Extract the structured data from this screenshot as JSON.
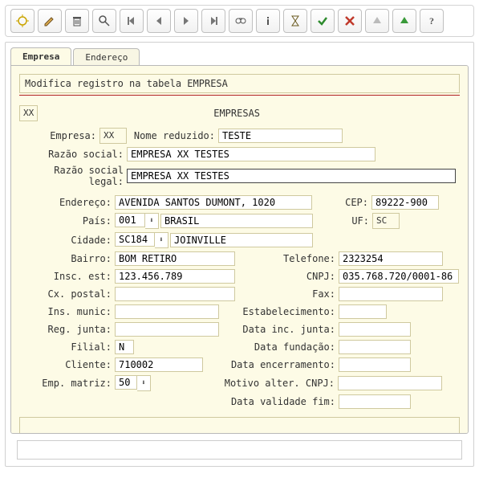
{
  "toolbar": {
    "icons": [
      "sun",
      "pencil",
      "trash",
      "zoom",
      "first",
      "prev",
      "next",
      "last",
      "binoculars",
      "info",
      "hourglass",
      "check-green",
      "x-red",
      "up-gray",
      "up-green",
      "help"
    ]
  },
  "tabs": {
    "empresa": "Empresa",
    "endereco": "Endereço"
  },
  "message": "Modifica registro na tabela EMPRESA",
  "section": {
    "code": "XX",
    "title": "EMPRESAS"
  },
  "form": {
    "empresa_label": "Empresa:",
    "empresa_code": "XX",
    "nome_red_label": "Nome reduzido:",
    "nome_red": "TESTE",
    "razao_label": "Razão social:",
    "razao": "EMPRESA XX TESTES",
    "razao_legal_label": "Razão social legal:",
    "razao_legal": "EMPRESA XX TESTES",
    "endereco_label": "Endereço:",
    "endereco": "AVENIDA SANTOS DUMONT, 1020",
    "cep_label": "CEP:",
    "cep": "89222-900",
    "pais_label": "País:",
    "pais_code": "001",
    "pais_nome": "BRASIL",
    "uf_label": "UF:",
    "uf": "SC",
    "cidade_label": "Cidade:",
    "cidade_code": "SC184",
    "cidade_nome": "JOINVILLE",
    "bairro_label": "Bairro:",
    "bairro": "BOM RETIRO",
    "telefone_label": "Telefone:",
    "telefone": "2323254",
    "insc_est_label": "Insc. est:",
    "insc_est": "123.456.789",
    "cnpj_label": "CNPJ:",
    "cnpj": "035.768.720/0001-86",
    "cx_postal_label": "Cx. postal:",
    "cx_postal": "",
    "fax_label": "Fax:",
    "fax": "",
    "ins_munic_label": "Ins. munic:",
    "ins_munic": "",
    "estab_label": "Estabelecimento:",
    "estab": "",
    "reg_junta_label": "Reg. junta:",
    "reg_junta": "",
    "data_inc_label": "Data inc. junta:",
    "data_inc": "",
    "filial_label": "Filial:",
    "filial": "N",
    "data_fund_label": "Data fundação:",
    "data_fund": "",
    "cliente_label": "Cliente:",
    "cliente": "710002",
    "data_enc_label": "Data encerramento:",
    "data_enc": "",
    "emp_matriz_label": "Emp. matriz:",
    "emp_matriz": "50",
    "motivo_label": "Motivo alter. CNPJ:",
    "motivo": "",
    "data_val_label": "Data validade fim:",
    "data_val": ""
  }
}
